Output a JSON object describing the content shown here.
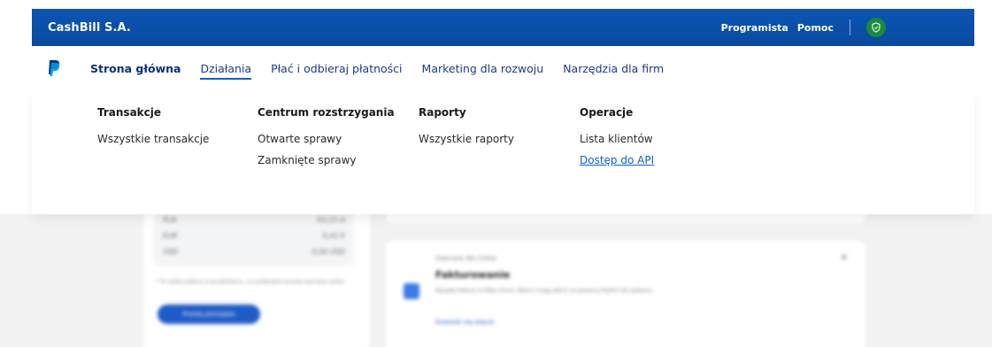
{
  "header": {
    "brand": "CashBill S.A.",
    "links": [
      "Programista",
      "Pomoc"
    ],
    "colors": {
      "bar": "#0a4fa8",
      "badge": "#1c8a3a"
    }
  },
  "nav": {
    "items": [
      {
        "label": "Strona główna"
      },
      {
        "label": "Działania"
      },
      {
        "label": "Płać i odbieraj płatności"
      },
      {
        "label": "Marketing dla rozwoju"
      },
      {
        "label": "Narzędzia dla firm"
      }
    ],
    "active_index": 1
  },
  "menu": {
    "columns": [
      {
        "heading": "Transakcje",
        "links": [
          "Wszystkie transakcje"
        ]
      },
      {
        "heading": "Centrum rozstrzygania",
        "links": [
          "Otwarte sprawy",
          "Zamknięte sprawy"
        ]
      },
      {
        "heading": "Raporty",
        "links": [
          "Wszystkie raporty"
        ]
      },
      {
        "heading": "Operacje",
        "links": [
          "Lista klientów",
          "Dostęp do API"
        ]
      }
    ]
  },
  "background": {
    "balances": [
      {
        "currency": "PLN",
        "amount": "43,23 zł"
      },
      {
        "currency": "EUR",
        "amount": "0,42 €"
      },
      {
        "currency": "USD",
        "amount": "0,00 USD"
      }
    ],
    "note": "* Te salda podane w przybliżeniu, na podstawie kursów wymiany walut",
    "transfer_button": "Przelej pieniądze",
    "card_small": "Zalecane dla Ciebie",
    "card_title": "Fakturowanie",
    "card_desc": "Wysyłaj faktury w kilka minut. Klienci mogą płacić za pomocą PayPal lub systemu.",
    "card_link": "Dowiedz się więcej"
  }
}
